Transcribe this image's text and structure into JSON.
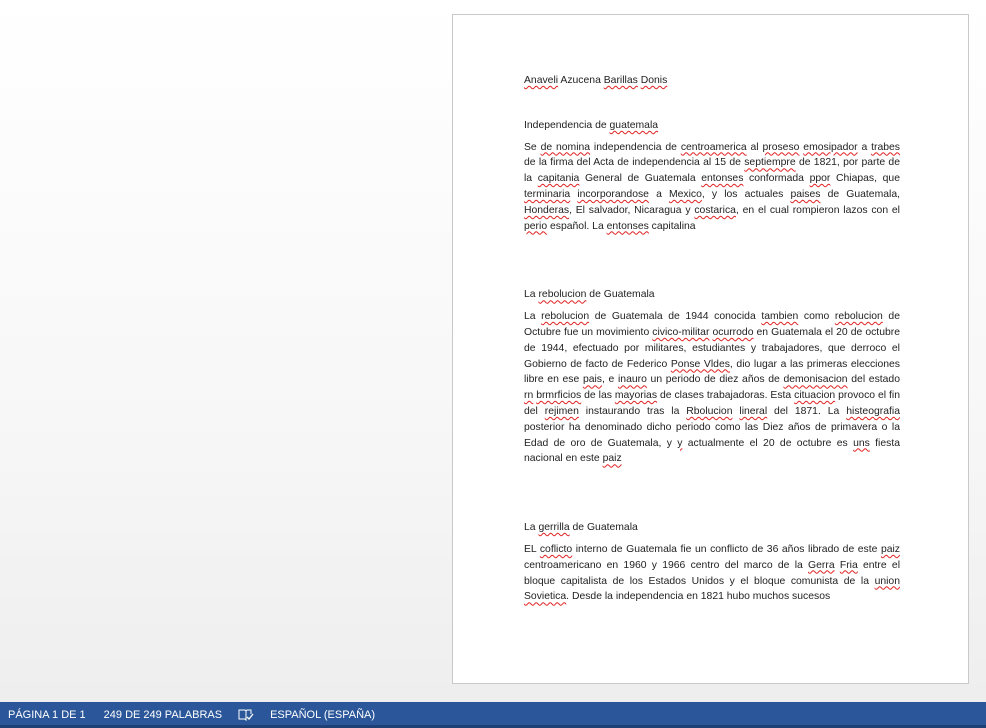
{
  "document": {
    "author": "Anaveli Azucena Barillas Donis",
    "sections": [
      {
        "title": "Independencia de guatemala",
        "body": "Se de nomina independencia de centroamerica al proseso emosipador a trabes de la firma del Acta de independencia al 15 de septiempre de 1821, por parte de la capitania General de Guatemala entonses conformada ppor Chiapas, que terminaria incorporandose a Mexico, y los actuales paises de Guatemala, Honderas, El salvador, Nicaragua y costarica, en el cual rompieron lazos con el perio español. La entonses capitalina"
      },
      {
        "title": "La rebolucion de Guatemala",
        "body": "La rebolucion de Guatemala de 1944 conocida tambien como rebolucion de Octubre fue un movimiento civico-militar ocurrodo en Guatemala el 20 de octubre de 1944, efectuado por militares, estudiantes y trabajadores, que derroco el Gobierno de facto de Federico Ponse Vldes, dio lugar a las primeras elecciones libre en ese pais, e inauro un periodo de diez años de demonisacion del estado rn brmrficios de las mayorias de clases trabajadoras. Esta cituacion provoco el fin del rejimen instaurando tras la Rbolucion lineral del 1871. La histeografia posterior ha denominado dicho periodo como las Diez años de primavera o la Edad de oro de Guatemala, y y actualmente el 20 de octubre es uns fiesta nacional en este paiz"
      },
      {
        "title": "La gerrilla de Guatemala",
        "body": "EL coflicto interno de Guatemala fie un conflicto de 36 años librado de este paiz centroamericano en 1960 y 1966 centro del marco de la Gerra Fria entre el bloque capitalista de los Estados Unidos y el bloque comunista de la union Sovietica. Desde la independencia en 1821 hubo muchos sucesos"
      }
    ],
    "misspelled_words": [
      "Anaveli",
      "Barillas",
      "Donis",
      "guatemala",
      "nomina",
      "centroamerica",
      "proseso",
      "emosipador",
      "trabes",
      "septiempre",
      "capitania",
      "entonses",
      "ppor",
      "terminaria",
      "incorporandose",
      "Mexico",
      "paises",
      "Honderas",
      "costarica",
      "perio",
      "rebolucion",
      "tambien",
      "civico-militar",
      "ocurrodo",
      "Ponse",
      "Vldes",
      "pais",
      "inauro",
      "demonisacion",
      "rn",
      "brmrficios",
      "mayorias",
      "cituacion",
      "rejimen",
      "Rbolucion",
      "lineral",
      "histeografia",
      "y",
      "uns",
      "paiz",
      "gerrilla",
      "coflicto",
      "Gerra",
      "Fria",
      "union",
      "Sovietica"
    ]
  },
  "statusbar": {
    "page": "PÁGINA 1 DE 1",
    "words": "249 DE 249 PALABRAS",
    "proofing_icon": "book-check-icon",
    "language": "ESPAÑOL (ESPAÑA)"
  },
  "colors": {
    "statusbar_bg": "#2b579a",
    "spellcheck_underline": "#e02020"
  }
}
